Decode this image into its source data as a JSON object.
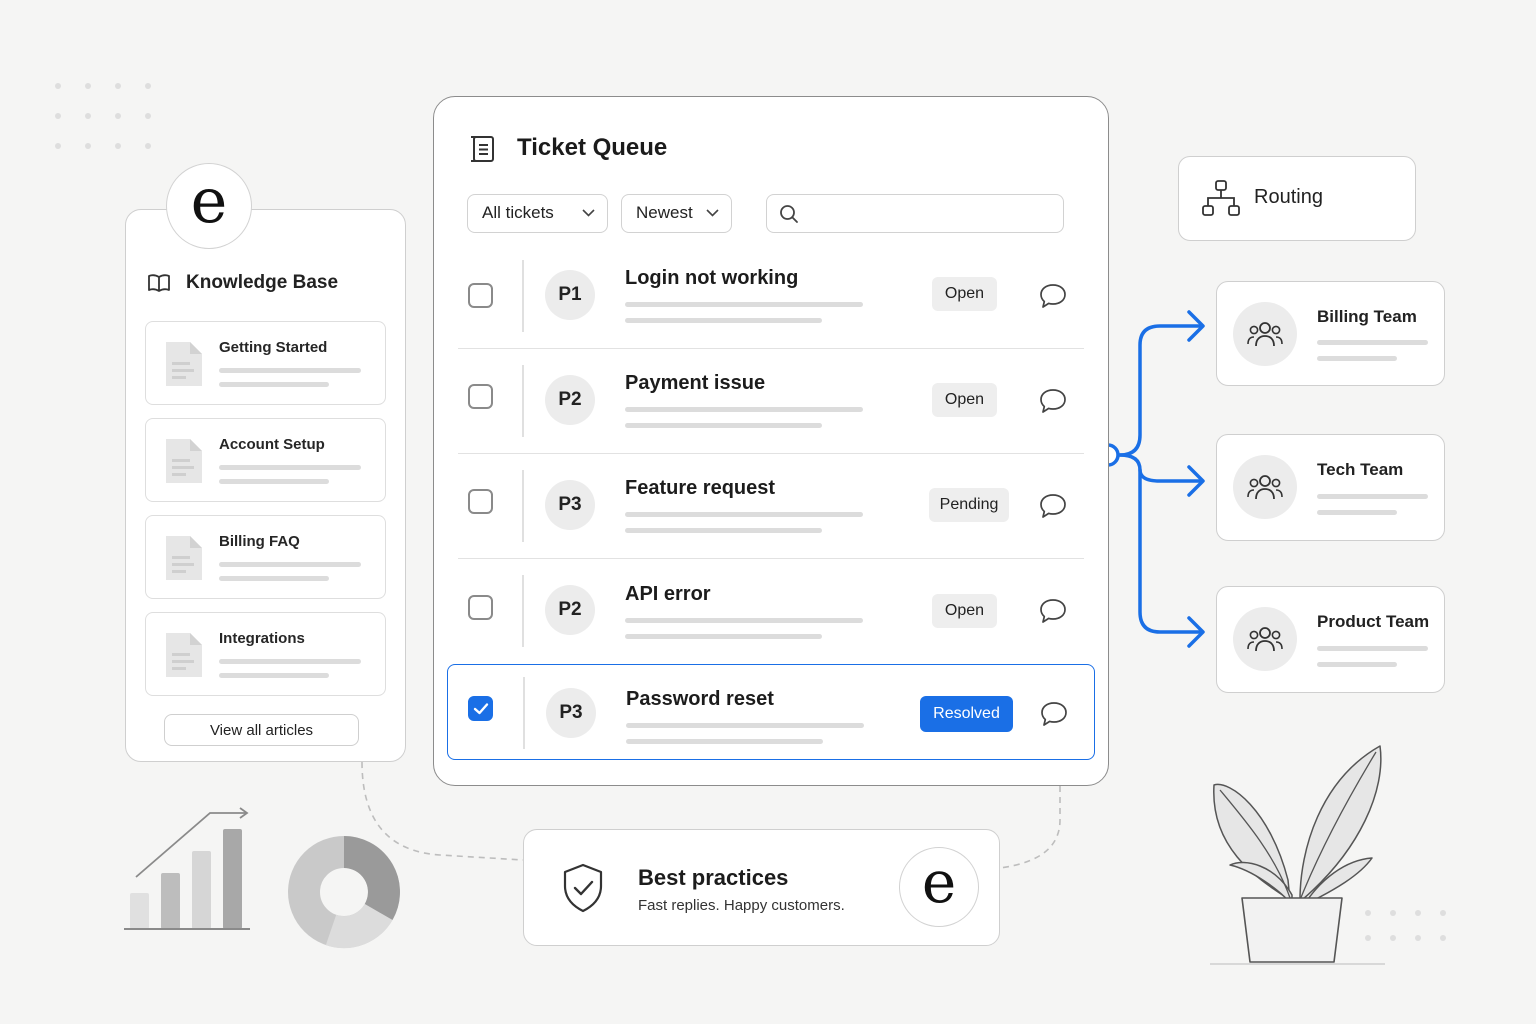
{
  "brand_letter": "e",
  "accent_color": "#1a6fe6",
  "knowledge_base": {
    "title": "Knowledge Base",
    "icon": "open-book-icon",
    "articles": [
      {
        "label": "Getting Started",
        "icon": "document-icon"
      },
      {
        "label": "Account Setup",
        "icon": "document-icon"
      },
      {
        "label": "Billing FAQ",
        "icon": "document-icon"
      },
      {
        "label": "Integrations",
        "icon": "document-icon"
      }
    ],
    "view_all_label": "View all articles"
  },
  "ticket_queue": {
    "title": "Ticket Queue",
    "icon": "list-icon",
    "filter_label": "All tickets",
    "sort_label": "Newest",
    "search_value": "",
    "tickets": [
      {
        "priority": "P1",
        "title": "Login not working",
        "status": "Open",
        "checked": false
      },
      {
        "priority": "P2",
        "title": "Payment issue",
        "status": "Open",
        "checked": false
      },
      {
        "priority": "P3",
        "title": "Feature request",
        "status": "Pending",
        "checked": false
      },
      {
        "priority": "P2",
        "title": "API error",
        "status": "Open",
        "checked": false
      },
      {
        "priority": "P3",
        "title": "Password reset",
        "status": "Resolved",
        "checked": true
      }
    ]
  },
  "routing": {
    "label": "Routing",
    "icon": "org-chart-icon",
    "teams": [
      {
        "name": "Billing Team",
        "icon": "team-icon"
      },
      {
        "name": "Tech Team",
        "icon": "team-icon"
      },
      {
        "name": "Product Team",
        "icon": "team-icon"
      }
    ]
  },
  "best_practices": {
    "title": "Best practices",
    "subtitle": "Fast replies. Happy customers.",
    "icon": "shield-check-icon"
  }
}
